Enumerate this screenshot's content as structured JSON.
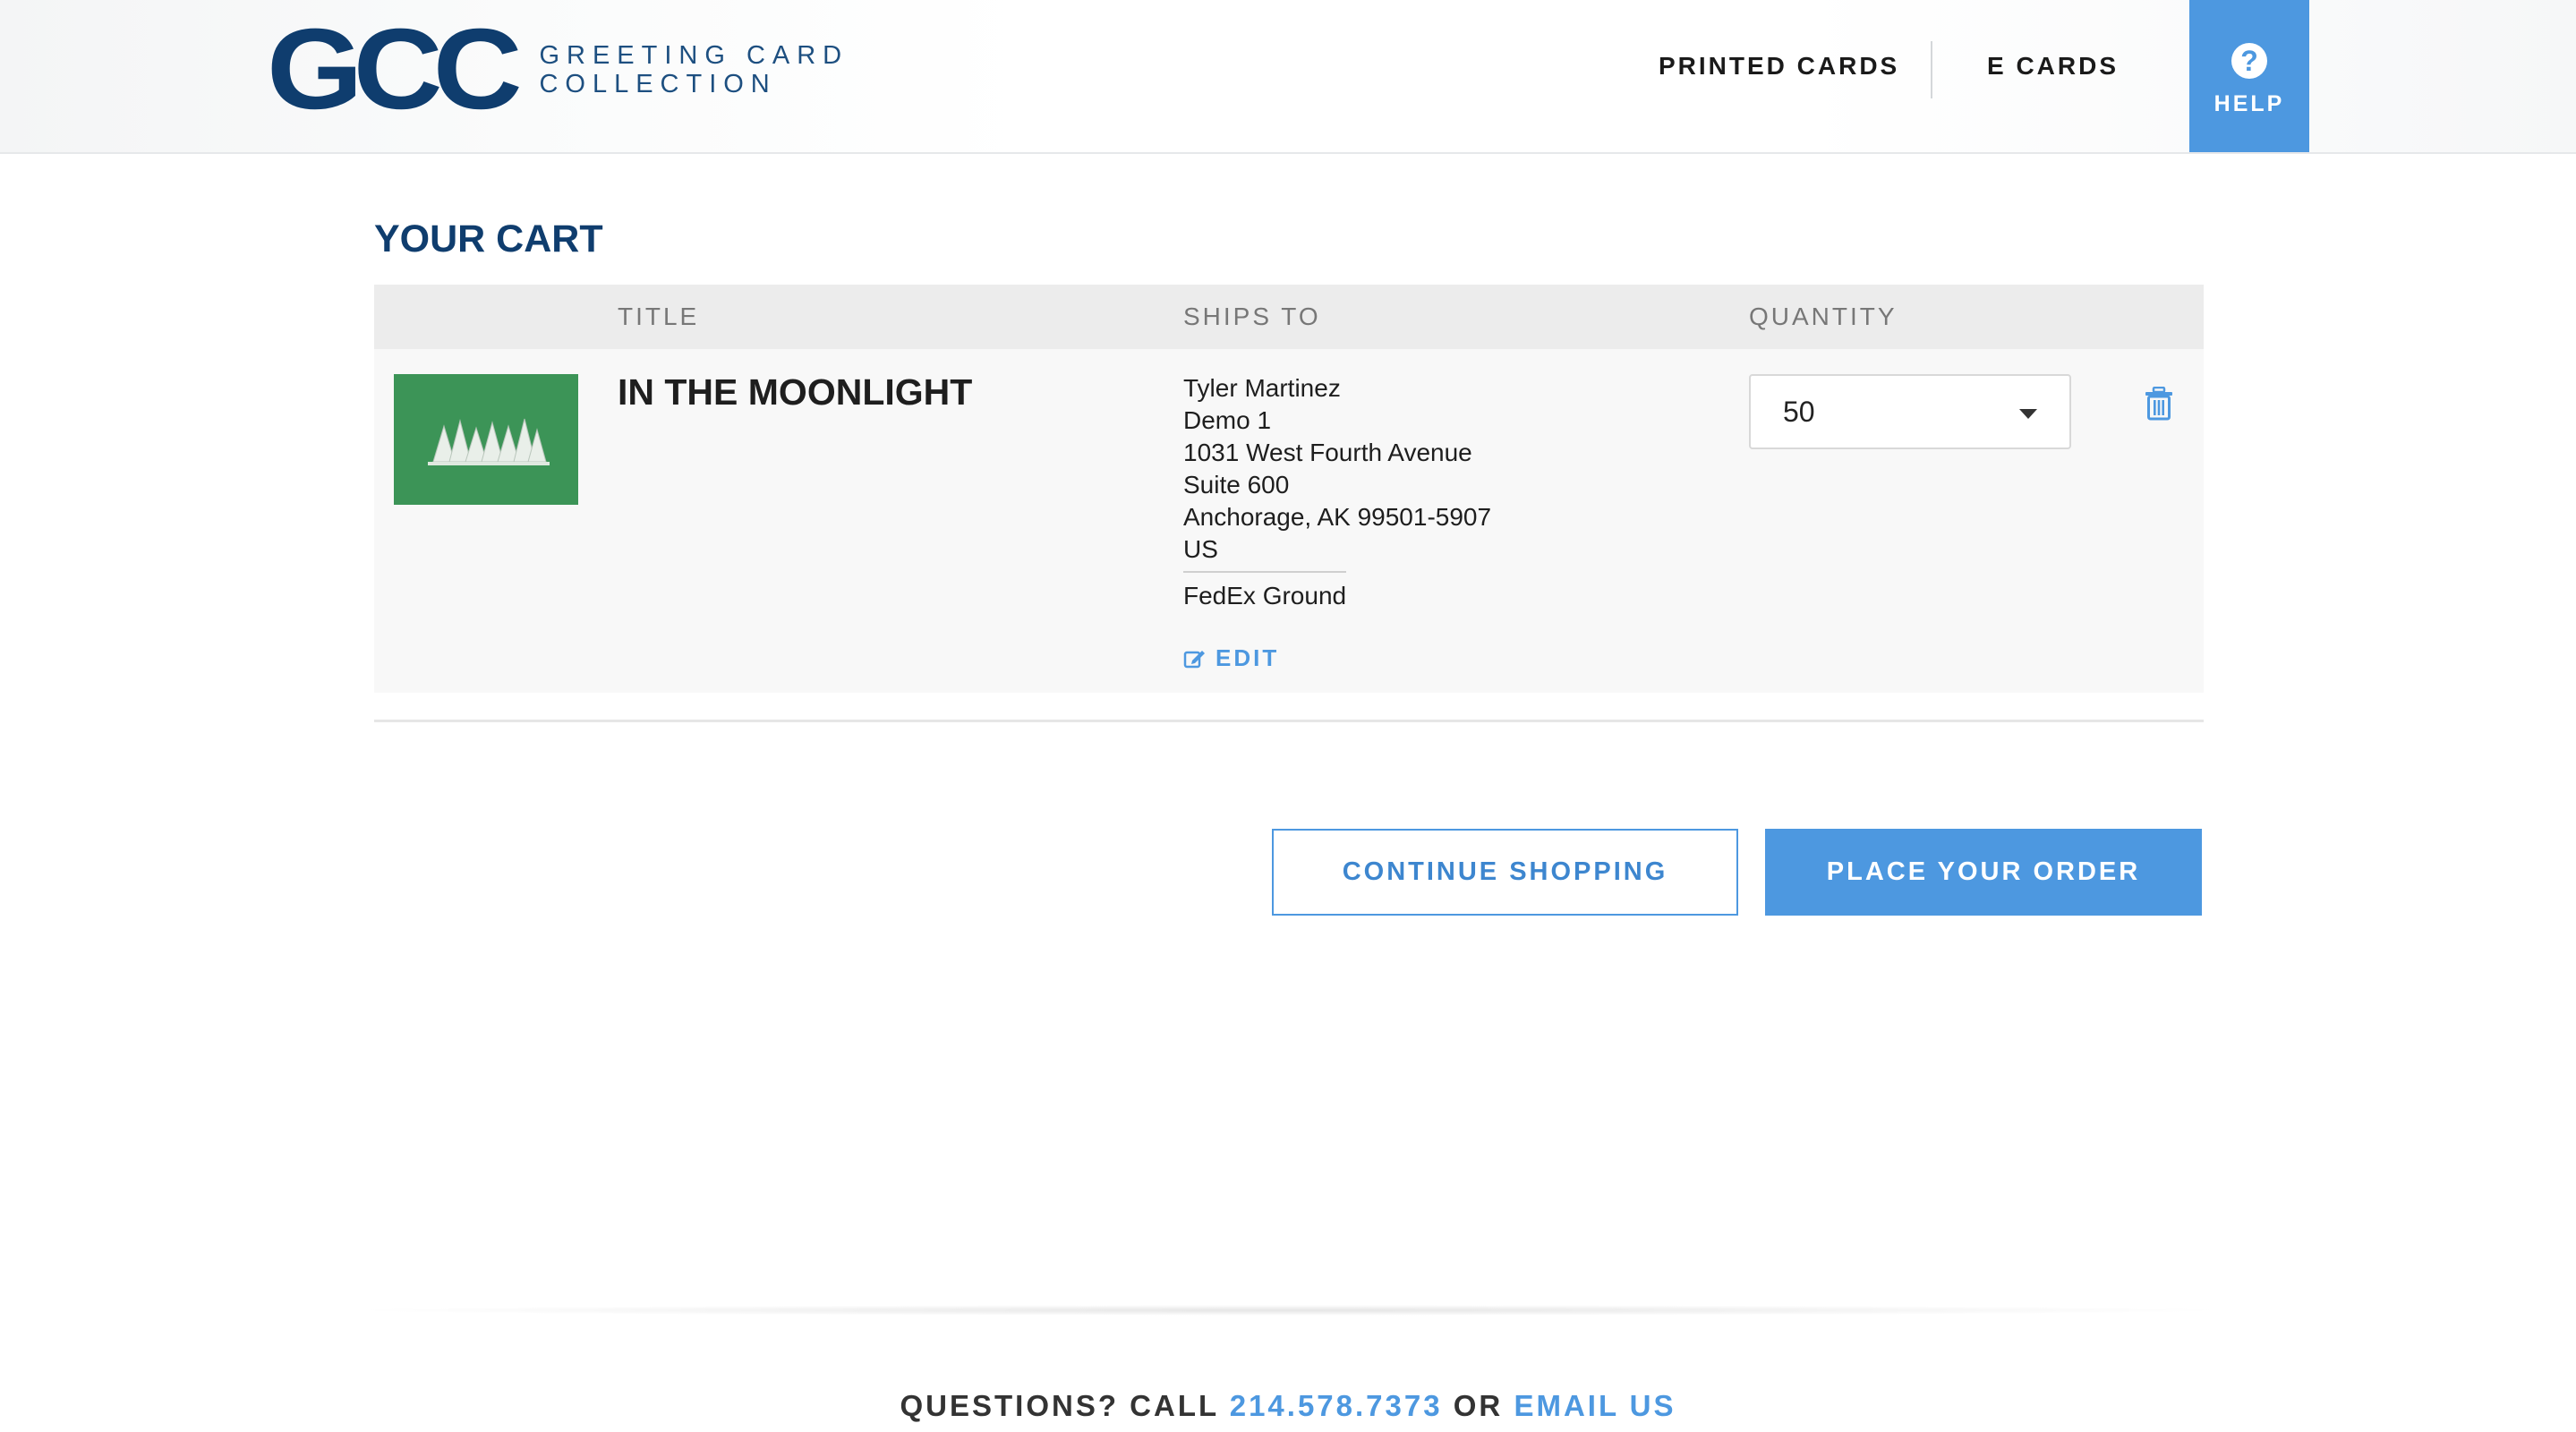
{
  "header": {
    "logo_mark": "GCC",
    "logo_line1": "GREETING CARD",
    "logo_line2": "COLLECTION",
    "nav": [
      {
        "label": "PRINTED CARDS"
      },
      {
        "label": "E CARDS"
      }
    ],
    "help_label": "HELP",
    "help_icon": "question-circle-icon"
  },
  "cart": {
    "title": "YOUR CART",
    "columns": {
      "title": "TITLE",
      "ships_to": "SHIPS TO",
      "quantity": "QUANTITY"
    },
    "items": [
      {
        "title": "IN THE MOONLIGHT",
        "thumbnail": "green card with snowy trees",
        "thumbnail_color": "#3c9457",
        "ships_to": {
          "name": "Tyler Martinez",
          "company": "Demo 1",
          "street": "1031 West Fourth Avenue",
          "suite": "Suite 600",
          "city_state_zip": "Anchorage, AK 99501-5907",
          "country": "US",
          "shipping_method": "FedEx Ground"
        },
        "edit_label": "EDIT",
        "quantity": "50"
      }
    ],
    "continue_label": "CONTINUE SHOPPING",
    "place_order_label": "PLACE YOUR ORDER"
  },
  "footer": {
    "prefix": "QUESTIONS? CALL",
    "phone": "214.578.7373",
    "or": "OR",
    "email_label": "EMAIL US"
  },
  "colors": {
    "brand_navy": "#0f3d6e",
    "accent_blue": "#4d98e0"
  }
}
